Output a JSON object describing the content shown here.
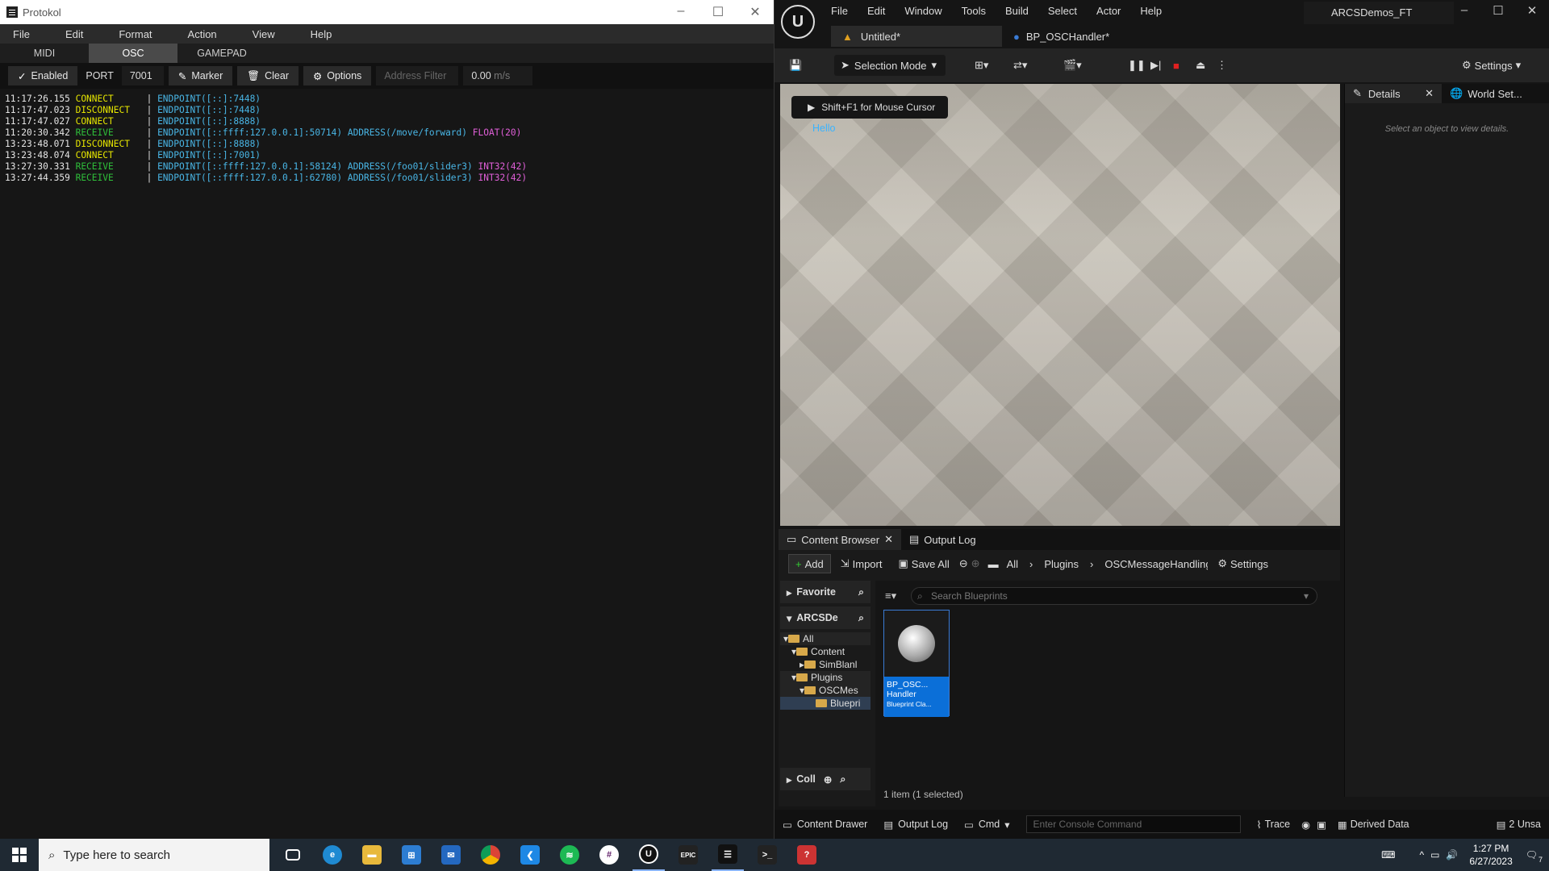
{
  "protokol": {
    "title": "Protokol",
    "menu": [
      "File",
      "Edit",
      "Format",
      "Action",
      "View",
      "Help"
    ],
    "tabs": [
      "MIDI",
      "OSC",
      "GAMEPAD"
    ],
    "active_tab": "OSC",
    "toolbar": {
      "enabled_label": "Enabled",
      "port_label": "PORT",
      "port_value": "7001",
      "marker_label": "Marker",
      "clear_label": "Clear",
      "options_label": "Options",
      "address_filter_placeholder": "Address Filter",
      "rate": "0.00",
      "rate_unit": "m/s"
    },
    "log": [
      {
        "time": "11:17:26.155",
        "event": "CONNECT",
        "endpoint": "ENDPOINT([::]:7448)",
        "address": "",
        "type": ""
      },
      {
        "time": "11:17:47.023",
        "event": "DISCONNECT",
        "endpoint": "ENDPOINT([::]:7448)",
        "address": "",
        "type": ""
      },
      {
        "time": "11:17:47.027",
        "event": "CONNECT",
        "endpoint": "ENDPOINT([::]:8888)",
        "address": "",
        "type": ""
      },
      {
        "time": "11:20:30.342",
        "event": "RECEIVE",
        "endpoint": "ENDPOINT([::ffff:127.0.0.1]:50714)",
        "address": "ADDRESS(/move/forward)",
        "type": "FLOAT(20)"
      },
      {
        "time": "13:23:48.071",
        "event": "DISCONNECT",
        "endpoint": "ENDPOINT([::]:8888)",
        "address": "",
        "type": ""
      },
      {
        "time": "13:23:48.074",
        "event": "CONNECT",
        "endpoint": "ENDPOINT([::]:7001)",
        "address": "",
        "type": ""
      },
      {
        "time": "13:27:30.331",
        "event": "RECEIVE",
        "endpoint": "ENDPOINT([::ffff:127.0.0.1]:58124)",
        "address": "ADDRESS(/foo01/slider3)",
        "type": "INT32(42)"
      },
      {
        "time": "13:27:44.359",
        "event": "RECEIVE",
        "endpoint": "ENDPOINT([::ffff:127.0.0.1]:62780)",
        "address": "ADDRESS(/foo01/slider3)",
        "type": "INT32(42)"
      }
    ]
  },
  "unreal": {
    "menu": [
      "File",
      "Edit",
      "Window",
      "Tools",
      "Build",
      "Select",
      "Actor",
      "Help"
    ],
    "project": "ARCSDemos_FT",
    "doc_tabs": [
      "Untitled*",
      "BP_OSCHandler*"
    ],
    "toolbar": {
      "selection_mode": "Selection Mode",
      "settings": "Settings"
    },
    "viewport": {
      "hint": "Shift+F1 for Mouse Cursor",
      "hello": "Hello"
    },
    "details": {
      "tabs": [
        "Details",
        "World Set..."
      ],
      "empty_message": "Select an object to view details."
    },
    "content_browser": {
      "tabs": [
        "Content Browser",
        "Output Log"
      ],
      "add": "Add",
      "import": "Import",
      "save_all": "Save All",
      "breadcrumb": [
        "All",
        "Plugins",
        "OSCMessageHandling Co"
      ],
      "settings": "Settings",
      "favorites": "Favorite",
      "project_section": "ARCSDe",
      "tree": [
        "All",
        "Content",
        "SimBlanl",
        "Plugins",
        "OSCMes",
        "Bluepri"
      ],
      "collections": "Coll",
      "search_placeholder": "Search Blueprints",
      "asset": {
        "name_line1": "BP_OSC...",
        "name_line2": "Handler",
        "kind": "Blueprint Cla..."
      },
      "count": "1 item (1 selected)"
    },
    "status": {
      "content_drawer": "Content Drawer",
      "output_log": "Output Log",
      "cmd": "Cmd",
      "console_placeholder": "Enter Console Command",
      "trace": "Trace",
      "derived_data": "Derived Data",
      "unsaved": "2 Unsa"
    }
  },
  "taskbar": {
    "search_placeholder": "Type here to search",
    "time": "1:27 PM",
    "date": "6/27/2023",
    "notification_count": "7"
  },
  "colors": {
    "connect": "#e5e500",
    "receive": "#2fbf3a",
    "endpoint": "#49b6e6",
    "type": "#e05fd8",
    "selection": "#0b6fd8"
  }
}
